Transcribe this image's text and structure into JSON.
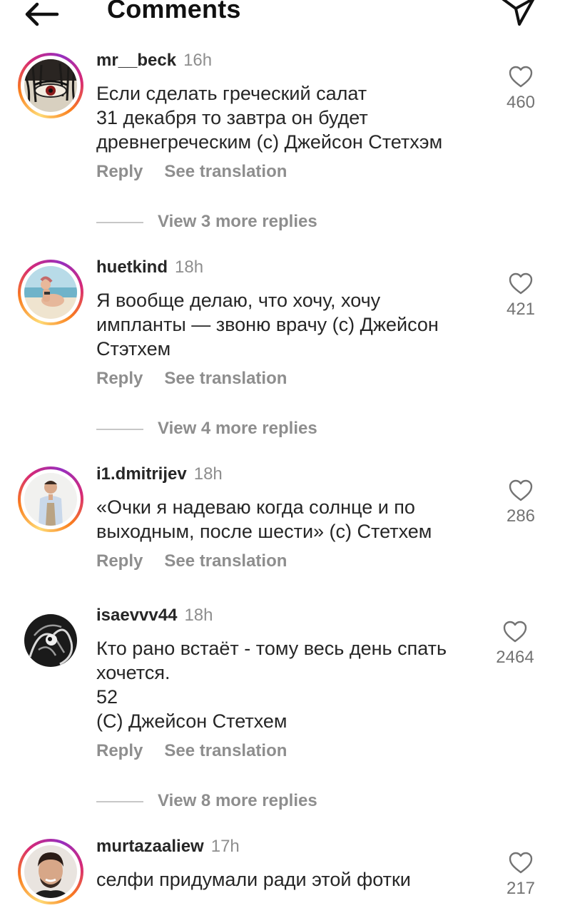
{
  "header": {
    "title": "Comments",
    "back_icon": "arrow-left-icon",
    "send_icon": "paper-plane-icon"
  },
  "actions": {
    "reply": "Reply",
    "see_translation": "See translation"
  },
  "comments": [
    {
      "username": "mr__beck",
      "time": "16h",
      "text": "Если сделать греческий салат\n31 декабря то завтра он будет\nдревнегреческим (с) Джейсон Стетхэм",
      "likes": "460",
      "view_replies": "View 3 more replies",
      "story_ring": true
    },
    {
      "username": "huetkind",
      "time": "18h",
      "text": "Я вообще делаю, что хочу, хочу\nимпланты — звоню врачу (с) Джейсон\nСтэтхем",
      "likes": "421",
      "view_replies": "View 4 more replies",
      "story_ring": true
    },
    {
      "username": "i1.dmitrijev",
      "time": "18h",
      "text": "«Очки я надеваю когда солнце и по\nвыходным, после шести» (с) Стетхем",
      "likes": "286",
      "story_ring": true
    },
    {
      "username": "isaevvv44",
      "time": "18h",
      "text": "Кто рано встаёт - тому весь день спать\nхочется.\n52\n(С) Джейсон Стетхем",
      "likes": "2464",
      "view_replies": "View 8 more replies",
      "story_ring": false
    },
    {
      "username": "murtazaaliew",
      "time": "17h",
      "text": "селфи придумали ради этой фотки",
      "likes": "217",
      "story_ring": true
    }
  ],
  "colors": {
    "text": "#262626",
    "muted": "#8e8e8e",
    "story_ring_gradient": [
      "#feda75",
      "#fa7e1e",
      "#d62976",
      "#962fbf"
    ]
  }
}
